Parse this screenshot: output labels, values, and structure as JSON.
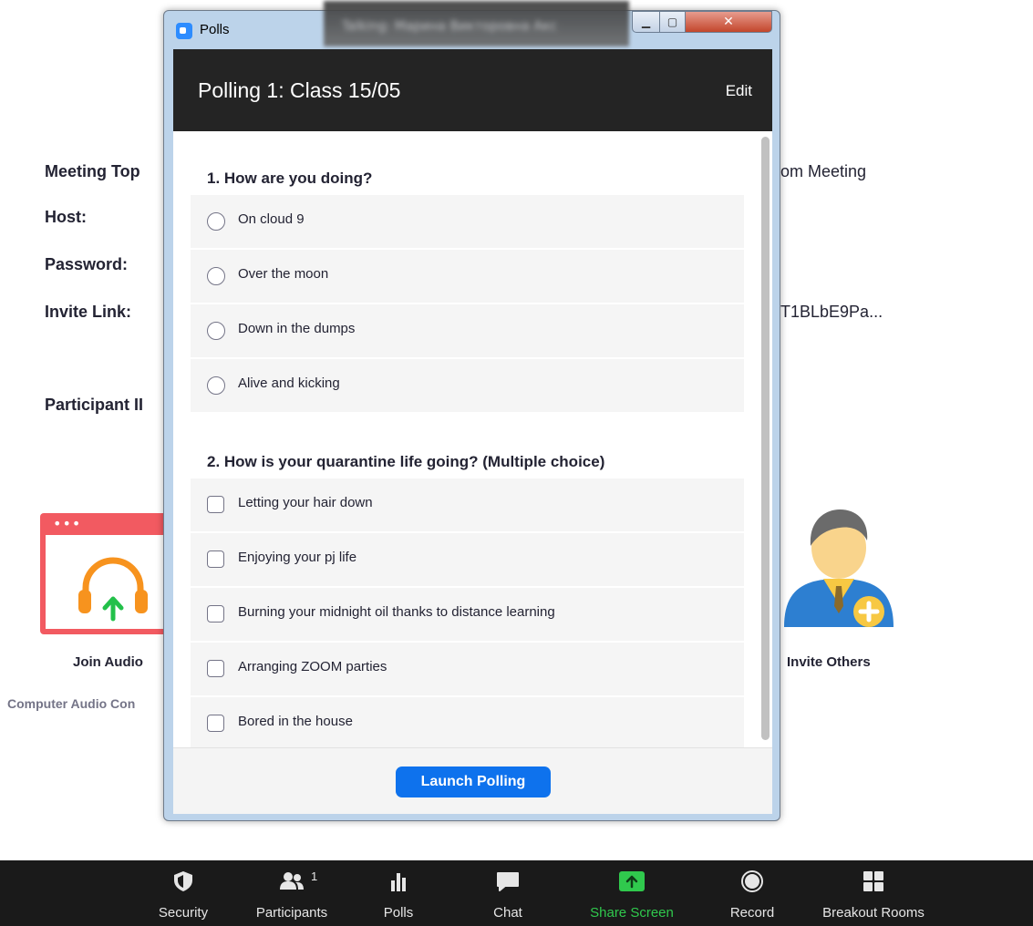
{
  "meeting_info": {
    "topic_label": "Meeting Top",
    "topic_value": "om Meeting",
    "host_label": "Host:",
    "password_label": "Password:",
    "invite_link_label": "Invite Link:",
    "invite_link_value": "T1BLbE9Pa...",
    "participant_id_label": "Participant II"
  },
  "tiles": {
    "join_audio_label": "Join Audio",
    "computer_audio_label": "Computer Audio Con",
    "invite_others_label": "Invite Others"
  },
  "polls_window": {
    "window_title": "Polls",
    "blurred_title": "Talking: Марина Викторовна Акс",
    "poll_title": "Polling 1: Class 15/05",
    "edit_label": "Edit",
    "questions": [
      {
        "title": "1. How are you doing?",
        "type": "single",
        "options": [
          "On cloud 9",
          "Over the moon",
          "Down in the dumps",
          "Alive and kicking"
        ]
      },
      {
        "title": "2. How is your quarantine life going? (Multiple choice)",
        "type": "multiple",
        "options": [
          "Letting your hair down",
          "Enjoying your pj life",
          "Burning your midnight oil thanks to distance learning",
          "Arranging ZOOM parties",
          "Bored in the house"
        ]
      }
    ],
    "launch_button": "Launch Polling"
  },
  "toolbar": {
    "security": "Security",
    "participants": "Participants",
    "participants_count": "1",
    "polls": "Polls",
    "chat": "Chat",
    "share_screen": "Share Screen",
    "record": "Record",
    "breakout_rooms": "Breakout Rooms"
  },
  "colors": {
    "accent_blue": "#0e72ed",
    "share_green": "#30c94d",
    "toolbar_bg": "#1a1a1a",
    "poll_header_bg": "#242424",
    "join_audio_red": "#f25a61",
    "headset_orange": "#f7931e"
  }
}
